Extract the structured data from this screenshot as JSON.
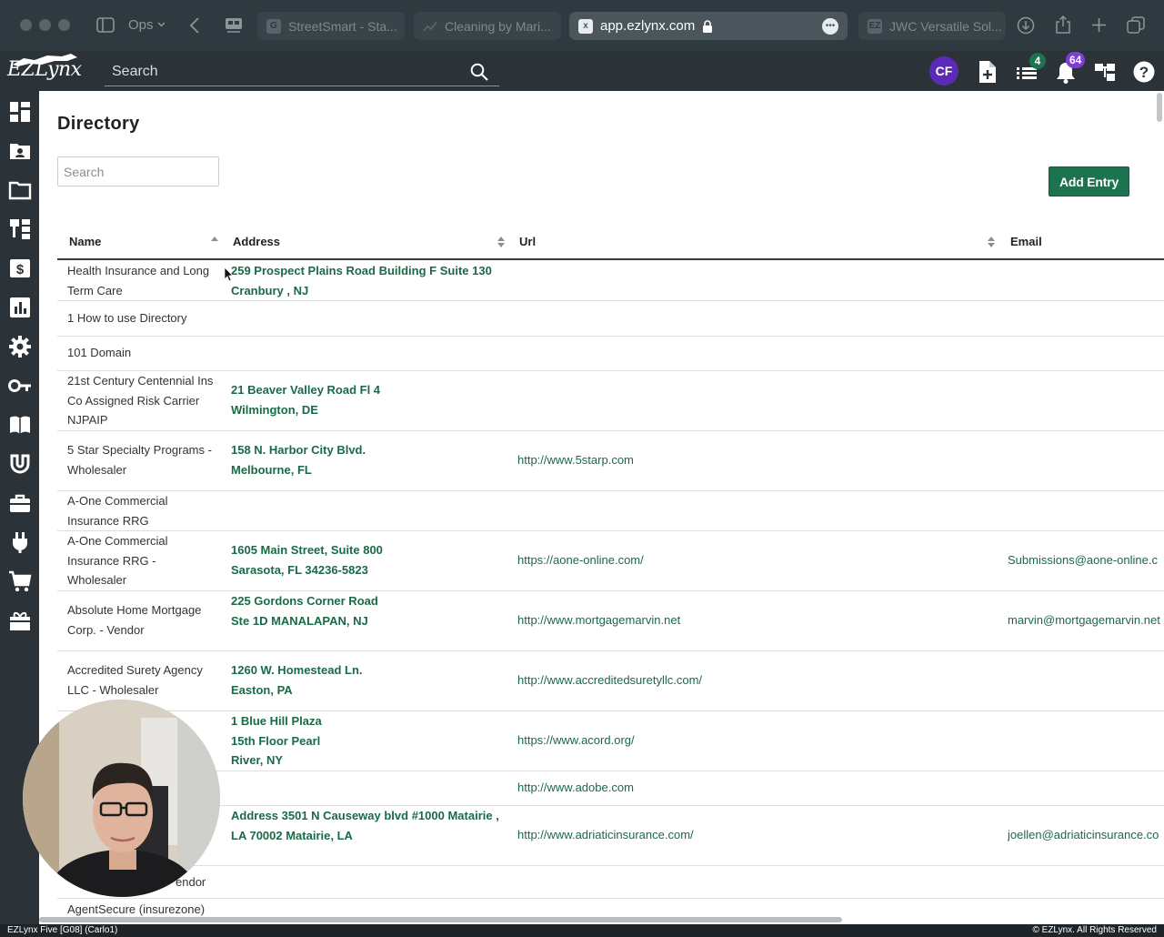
{
  "browser": {
    "sidebar_label": "Ops",
    "tabs": [
      {
        "label": "StreetSmart - Sta...",
        "favicon": "G"
      },
      {
        "label": "Cleaning by Mari...",
        "favicon": ""
      },
      {
        "label": "app.ezlynx.com",
        "favicon": "x",
        "active": true
      },
      {
        "label": "JWC Versatile Sol...",
        "favicon": "EZ"
      }
    ]
  },
  "header": {
    "logo_main": "EZLynx",
    "search_placeholder": "Search",
    "avatar_initials": "CF",
    "tasks_badge": "4",
    "notifications_badge": "64",
    "colors": {
      "tasks_badge": "#1d7350",
      "notifications_badge": "#7b3fd1",
      "avatar": "#5b2bb8"
    }
  },
  "page": {
    "title": "Directory",
    "search_placeholder": "Search",
    "add_button": "Add Entry",
    "columns": [
      "Name",
      "Address",
      "Url",
      "Email"
    ]
  },
  "rows": [
    {
      "name": "Health Insurance and Long Term Care",
      "address": "259 Prospect Plains Road Building F Suite 130 Cranbury , NJ",
      "url": "",
      "email": ""
    },
    {
      "name": "1 How to use Directory",
      "address": "",
      "url": "",
      "email": ""
    },
    {
      "name": "101 Domain",
      "address": "",
      "url": "",
      "email": ""
    },
    {
      "name": "21st Century Centennial Ins Co Assigned Risk Carrier NJPAIP",
      "address": "21 Beaver Valley Road Fl 4 Wilmington, DE",
      "url": "",
      "email": ""
    },
    {
      "name": "5 Star Specialty Programs - Wholesaler",
      "address": "158 N. Harbor City Blvd. Melbourne, FL",
      "url": "http://www.5starp.com",
      "email": ""
    },
    {
      "name": "A-One Commercial Insurance RRG",
      "address": "",
      "url": "",
      "email": ""
    },
    {
      "name": "A-One Commercial Insurance RRG - Wholesaler",
      "address": "1605 Main Street, Suite 800 Sarasota, FL 34236-5823",
      "url": "https://aone-online.com/",
      "email": "Submissions@aone-online.c"
    },
    {
      "name": "Absolute Home Mortgage Corp. - Vendor",
      "address": "225 Gordons Corner Road Ste 1D MANALAPAN, NJ",
      "url": "http://www.mortgagemarvin.net",
      "email": "marvin@mortgagemarvin.net"
    },
    {
      "name": "Accredited Surety Agency LLC - Wholesaler",
      "address": "1260 W. Homestead Ln. Easton, PA",
      "url": "http://www.accreditedsuretyllc.com/",
      "email": ""
    },
    {
      "name": "",
      "address": "1 Blue Hill Plaza 15th Floor Pearl River, NY",
      "url": "https://www.acord.org/",
      "email": ""
    },
    {
      "name": "",
      "address": "",
      "url": "http://www.adobe.com",
      "email": ""
    },
    {
      "name": "",
      "address": "Address 3501 N Causeway blvd #1000 Matairie , LA 70002 Matairie, LA",
      "url": "http://www.adriaticinsurance.com/",
      "email": "joellen@adriaticinsurance.co"
    },
    {
      "name": "endor",
      "address": "",
      "url": "",
      "email": ""
    },
    {
      "name": "AgentSecure (insurezone)",
      "address": "",
      "url": "",
      "email": ""
    }
  ],
  "footer": {
    "left": "EZLynx Five [G08] (Carlo1)",
    "right": "© EZLynx. All Rights Reserved"
  }
}
